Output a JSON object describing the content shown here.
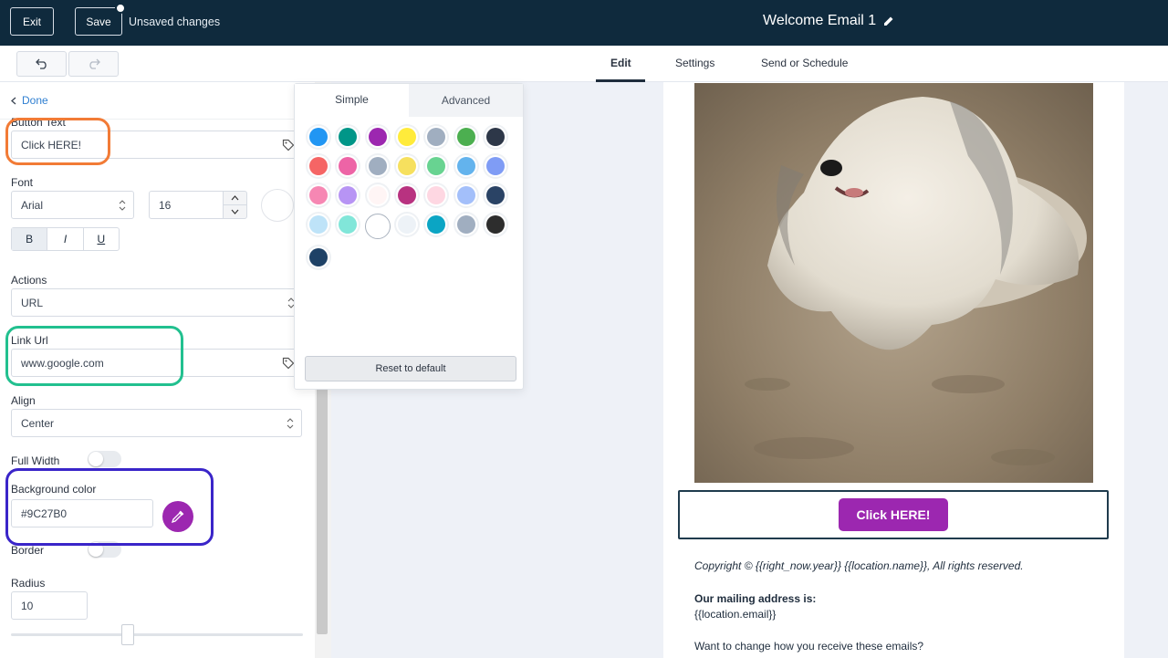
{
  "header": {
    "exit_label": "Exit",
    "save_label": "Save",
    "unsaved_text": "Unsaved changes",
    "title": "Welcome Email 1"
  },
  "tabs": [
    {
      "label": "Edit",
      "active": true
    },
    {
      "label": "Settings"
    },
    {
      "label": "Send or Schedule"
    }
  ],
  "left_panel": {
    "done_label": "Done",
    "button_text_label": "Button Text",
    "button_text_value": "Click HERE!",
    "font_label": "Font",
    "font_value": "Arial",
    "font_size": "16",
    "bold_label": "B",
    "italic_label": "I",
    "underline_label": "U",
    "actions_label": "Actions",
    "actions_value": "URL",
    "link_url_label": "Link Url",
    "link_url_value": "www.google.com",
    "align_label": "Align",
    "align_value": "Center",
    "full_width_label": "Full Width",
    "background_color_label": "Background color",
    "background_color_value": "#9C27B0",
    "border_label": "Border",
    "radius_label": "Radius",
    "radius_value": "10",
    "radius_slider_fraction": 0.4
  },
  "color_picker": {
    "tab_simple": "Simple",
    "tab_advanced": "Advanced",
    "swatches": [
      "#2196F3",
      "#009688",
      "#9C27B0",
      "#FFEB3B",
      "#A0AEC0",
      "#4CAF50",
      "#2D3748",
      "#F56565",
      "#ED64A6",
      "#A0AEC0",
      "#F6E05E",
      "#68D391",
      "#63B3ED",
      "#7F9CF5",
      "#F687B3",
      "#B794F4",
      "#FFF5F5",
      "#B83280",
      "#FED7E2",
      "#A3BFFA",
      "#2A4365",
      "#BEE3F8",
      "#81E6D9",
      "#FFFFFF",
      "#EDF2F7",
      "#0BA5C4",
      "#A0AEC0",
      "#2D2D2D",
      "#1E4166"
    ],
    "reset_label": "Reset to default"
  },
  "preview": {
    "button_label": "Click HERE!",
    "copyright": "Copyright © {{right_now.year}}  {{location.name}}, All rights reserved.",
    "mailing_heading": "Our mailing address is:",
    "mailing_value": "{{location.email}}",
    "change_text": "Want to change how you receive these emails?"
  },
  "colors": {
    "topbar": "#0f2a3d",
    "accent_link": "#2f7fd1",
    "button_bg": "#9C27B0"
  }
}
